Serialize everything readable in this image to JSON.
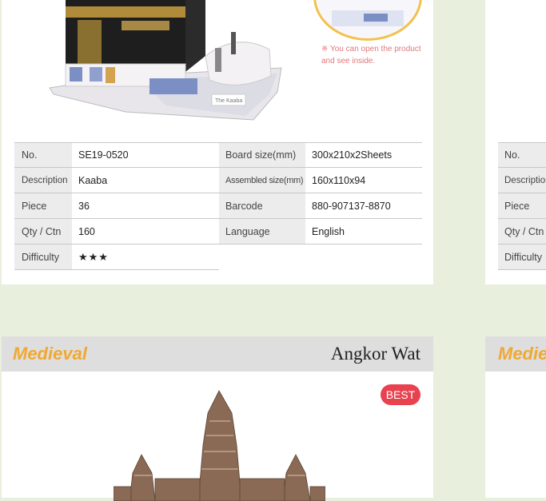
{
  "kaaba_card": {
    "image_label": "The Kaaba",
    "inset_note": "※ You can open the product and see inside.",
    "specs": {
      "no_label": "No.",
      "no_value": "SE19-0520",
      "board_label": "Board size(mm)",
      "board_value": "300x210x2Sheets",
      "desc_label": "Description",
      "desc_value": "Kaaba",
      "assembled_label": "Assembled size(mm)",
      "assembled_value": "160x110x94",
      "piece_label": "Piece",
      "piece_value": "36",
      "barcode_label": "Barcode",
      "barcode_value": "880-907137-8870",
      "qty_label": "Qty / Ctn",
      "qty_value": "160",
      "language_label": "Language",
      "language_value": "English",
      "difficulty_label": "Difficulty",
      "difficulty_value": "★★★"
    }
  },
  "angkor_card": {
    "category": "Medieval",
    "title": "Angkor Wat",
    "badge": "BEST"
  },
  "right_card_top": {
    "labels": [
      "No.",
      "Description",
      "Piece",
      "Qty / Ctn",
      "Difficulty"
    ]
  },
  "right_card_bottom": {
    "category": "Medieval"
  },
  "colors": {
    "background": "#e9efdd",
    "accent_orange": "#f0a832",
    "badge_red": "#e8424f",
    "note_pink": "#e2787a"
  }
}
